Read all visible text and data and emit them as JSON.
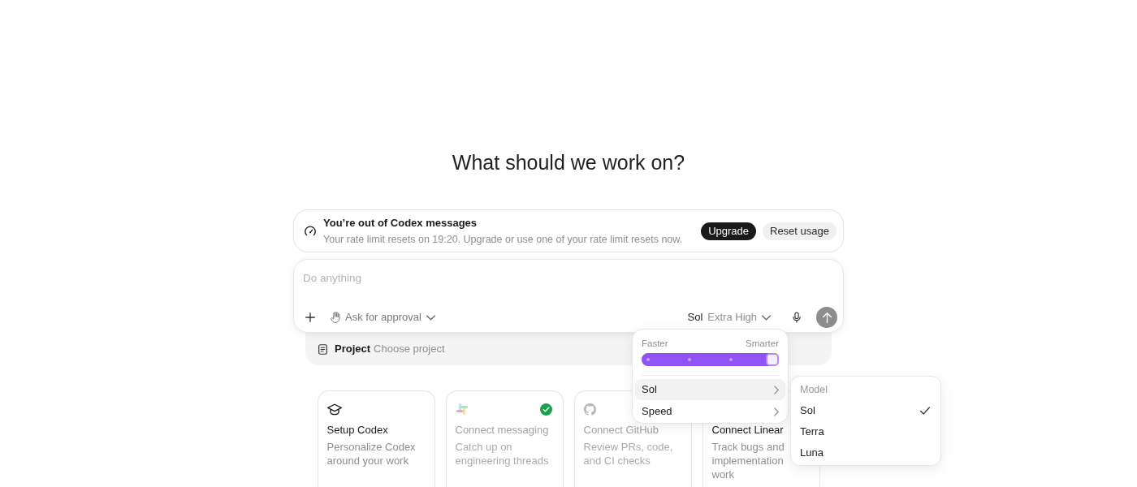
{
  "heading": "What should we work on?",
  "notice": {
    "title": "You’re out of Codex messages",
    "text": "Your rate limit resets on 19:20. Upgrade or use one of your rate limit resets now.",
    "buttons": [
      {
        "label": "Upgrade",
        "kind": "primary"
      },
      {
        "label": "Reset usage",
        "kind": "secondary"
      }
    ]
  },
  "composer": {
    "placeholder": "Do anything",
    "approval": "Ask for approval",
    "model": "Sol",
    "effort": "Extra High"
  },
  "project": {
    "label": "Project",
    "prompt": "Choose project"
  },
  "cards": [
    {
      "kind": "setup",
      "title": "Setup Codex",
      "text": "Personalize Codex around your work",
      "disabled": false,
      "connected": false
    },
    {
      "kind": "messaging",
      "title": "Connect messaging",
      "text": "Catch up on engineering threads",
      "disabled": true,
      "connected": true
    },
    {
      "kind": "code",
      "title": "Connect GitHub",
      "text": "Review PRs, code, and CI checks",
      "disabled": true,
      "connected": false
    },
    {
      "kind": "tracker",
      "title": "Connect Linear",
      "text": "Track bugs and implementation work",
      "disabled": false,
      "connected": false
    }
  ],
  "effort_menu": {
    "left_label": "Faster",
    "right_label": "Smarter",
    "level": 1,
    "items": [
      {
        "label": "Sol",
        "selected": true
      },
      {
        "label": "Speed",
        "selected": false
      }
    ]
  },
  "model_menu": {
    "header": "Model",
    "items": [
      {
        "label": "Sol",
        "selected": true
      },
      {
        "label": "Terra",
        "selected": false
      },
      {
        "label": "Luna",
        "selected": false
      }
    ]
  }
}
